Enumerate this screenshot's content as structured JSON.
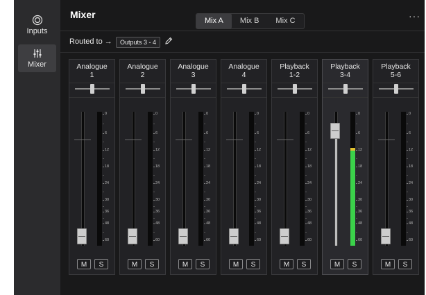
{
  "sidebar": {
    "items": [
      {
        "label": "Inputs",
        "icon": "target-icon",
        "active": false
      },
      {
        "label": "Mixer",
        "icon": "sliders-icon",
        "active": true
      }
    ]
  },
  "header": {
    "title": "Mixer",
    "tabs": [
      {
        "label": "Mix A",
        "active": true
      },
      {
        "label": "Mix B",
        "active": false
      },
      {
        "label": "Mix C",
        "active": false
      }
    ],
    "more_label": "···"
  },
  "routing": {
    "label": "Routed to →",
    "value": "Outputs 3 - 4"
  },
  "meter_scale": [
    "0",
    "6",
    "12",
    "18",
    "24",
    "30",
    "36",
    "48",
    "60"
  ],
  "channels": [
    {
      "line1": "Analogue",
      "line2": "1",
      "fader_level": 0,
      "meter_level": 0,
      "mute": "M",
      "solo": "S"
    },
    {
      "line1": "Analogue",
      "line2": "2",
      "fader_level": 0,
      "meter_level": 0,
      "mute": "M",
      "solo": "S"
    },
    {
      "line1": "Analogue",
      "line2": "3",
      "fader_level": 0,
      "meter_level": 0,
      "mute": "M",
      "solo": "S"
    },
    {
      "line1": "Analogue",
      "line2": "4",
      "fader_level": 0,
      "meter_level": 0,
      "mute": "M",
      "solo": "S"
    },
    {
      "line1": "Playback",
      "line2": "1-2",
      "fader_level": 0,
      "meter_level": 0,
      "mute": "M",
      "solo": "S"
    },
    {
      "line1": "Playback",
      "line2": "3-4",
      "fader_level": 0.86,
      "meter_level": 0.73,
      "mute": "M",
      "solo": "S",
      "selected": true
    },
    {
      "line1": "Playback",
      "line2": "5-6",
      "fader_level": 0,
      "meter_level": 0,
      "mute": "M",
      "solo": "S"
    }
  ],
  "colors": {
    "meter_green": "#3bd24a",
    "meter_yellow": "#e0c12e"
  }
}
